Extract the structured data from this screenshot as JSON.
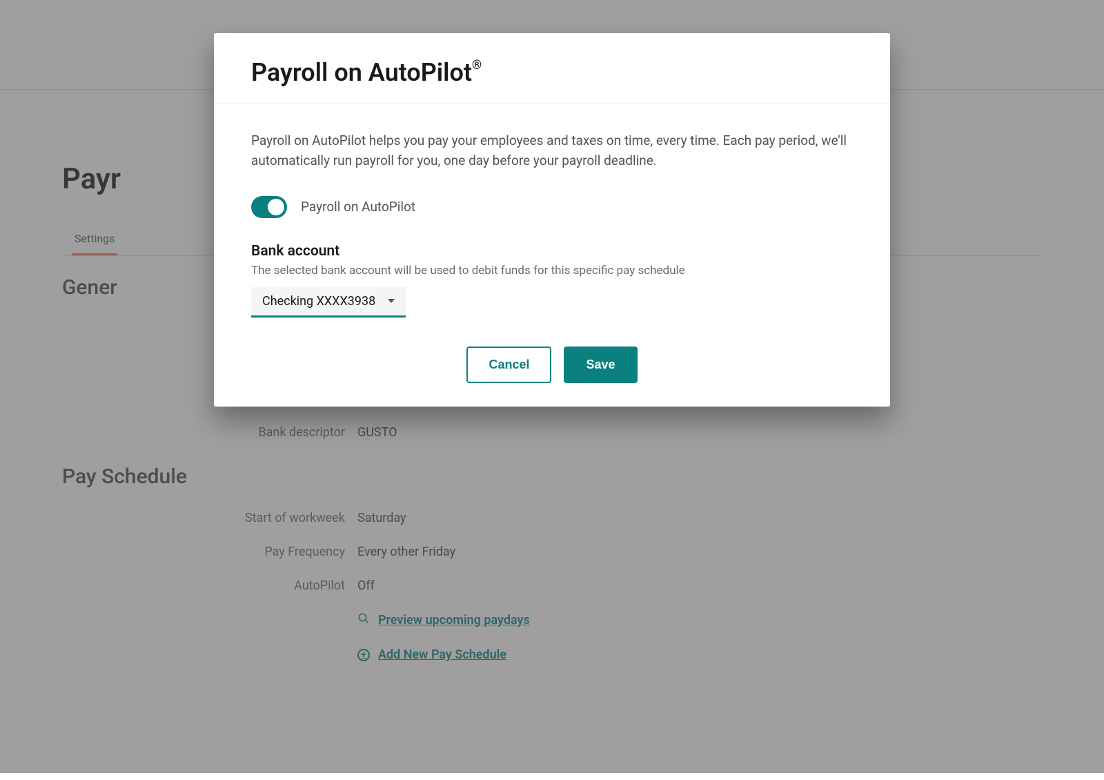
{
  "background": {
    "page_title_visible": "Payr",
    "tabs": {
      "active": "Settings"
    },
    "section_general": "Gener",
    "bank_descriptor_label": "Bank descriptor",
    "bank_descriptor_value": "GUSTO",
    "pay_schedule_title": "Pay Schedule",
    "rows": {
      "start_label": "Start of workweek",
      "start_value": "Saturday",
      "freq_label": "Pay Frequency",
      "freq_value": "Every other Friday",
      "autopilot_label": "AutoPilot",
      "autopilot_value": "Off"
    },
    "links": {
      "preview": "Preview upcoming paydays",
      "add_new": "Add New Pay Schedule"
    }
  },
  "modal": {
    "title": "Payroll on AutoPilot",
    "title_suffix": "®",
    "description": "Payroll on AutoPilot helps you pay your employees and taxes on time, every time. Each pay period, we'll automatically run payroll for you, one day before your payroll deadline.",
    "toggle": {
      "label": "Payroll on AutoPilot",
      "on": true
    },
    "bank_account": {
      "label": "Bank account",
      "help": "The selected bank account will be used to debit funds for this specific pay schedule",
      "selected": "Checking XXXX3938"
    },
    "buttons": {
      "cancel": "Cancel",
      "save": "Save"
    }
  }
}
